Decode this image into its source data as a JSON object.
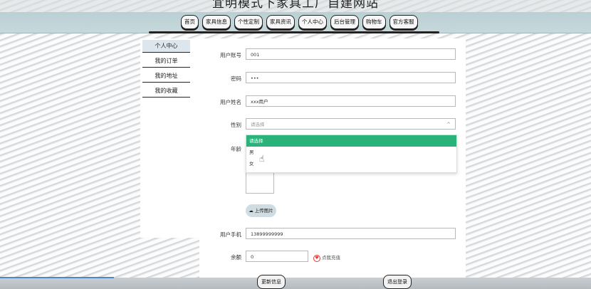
{
  "site": {
    "title": "宜明模式下家具工厂自建网站"
  },
  "nav": {
    "items": [
      "首页",
      "家具信息",
      "个性定制",
      "家具资讯",
      "个人中心",
      "后台管理",
      "购物车",
      "官方客服"
    ]
  },
  "sidebar": {
    "items": [
      "个人中心",
      "我的订单",
      "我的地址",
      "我的收藏"
    ]
  },
  "form": {
    "account_label": "用户账号",
    "account_value": "001",
    "password_label": "密码",
    "password_value": "•••",
    "name_label": "用户姓名",
    "name_value": "xxx用户",
    "gender_label": "性别",
    "gender_placeholder": "请选择",
    "gender_options": [
      "请选择",
      "男",
      "女"
    ],
    "age_label": "年龄",
    "upload_label": "上传图片",
    "phone_label": "用户手机",
    "phone_value": "13899999999",
    "balance_label": "余额",
    "balance_value": "0",
    "recharge_label": "点我充值"
  },
  "actions": {
    "update_label": "更新信息",
    "logout_label": "退出登录"
  },
  "colors": {
    "selected_option": "#2ab27b",
    "navbar": "#c3d6d9"
  }
}
